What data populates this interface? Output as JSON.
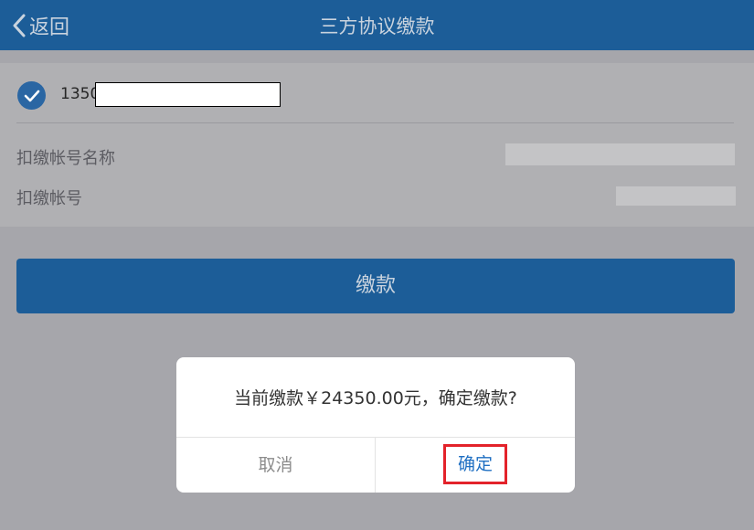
{
  "nav": {
    "back_label": "返回",
    "title": "三方协议缴款"
  },
  "account": {
    "phone_prefix": "1350",
    "checked": true,
    "rows": [
      {
        "label": "扣缴帐号名称"
      },
      {
        "label": "扣缴帐号"
      }
    ]
  },
  "pay_button_label": "缴款",
  "dialog": {
    "message": "当前缴款￥24350.00元，确定缴款?",
    "cancel_label": "取消",
    "confirm_label": "确定"
  },
  "colors": {
    "primary": "#1c5d98",
    "highlight_border": "#e3222a",
    "link": "#1f6fc2"
  },
  "icons": {
    "back": "chevron-left-icon",
    "check": "checkmark-circle-icon"
  }
}
